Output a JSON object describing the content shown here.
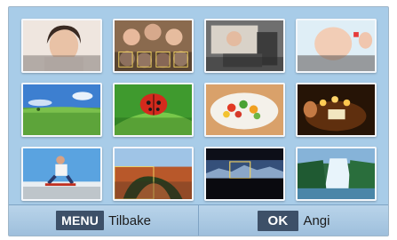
{
  "footer": {
    "back": {
      "key": "MENU",
      "label": "Tilbake"
    },
    "confirm": {
      "key": "OK",
      "label": "Angi"
    }
  },
  "thumbnails": [
    {
      "name": "portrait-woman"
    },
    {
      "name": "group-faces"
    },
    {
      "name": "child-photo-frames"
    },
    {
      "name": "baby-smiling"
    },
    {
      "name": "green-landscape"
    },
    {
      "name": "ladybug-leaf"
    },
    {
      "name": "salad-plate"
    },
    {
      "name": "birthday-candles"
    },
    {
      "name": "skater-jump"
    },
    {
      "name": "canyon-bend"
    },
    {
      "name": "night-panorama"
    },
    {
      "name": "waterfall"
    }
  ]
}
